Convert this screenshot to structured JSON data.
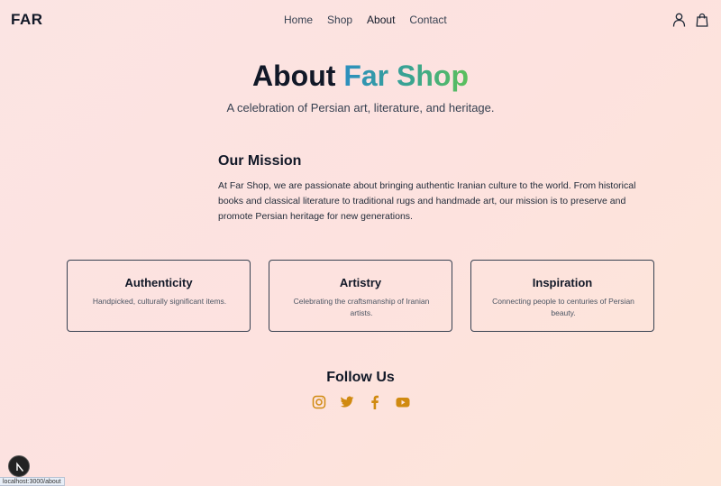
{
  "header": {
    "logo": "FAR",
    "nav": [
      "Home",
      "Shop",
      "About",
      "Contact"
    ],
    "active_nav": "About",
    "icons": [
      "user-icon",
      "shopping-bag-icon"
    ]
  },
  "hero": {
    "title_prefix": "About",
    "title_highlight": "Far Shop",
    "subtitle": "A celebration of Persian art, literature, and heritage."
  },
  "mission": {
    "title": "Our Mission",
    "text": "At Far Shop, we are passionate about bringing authentic Iranian culture to the world. From historical books and classical literature to traditional rugs and handmade art, our mission is to preserve and promote Persian heritage for new generations."
  },
  "cards": [
    {
      "title": "Authenticity",
      "text": "Handpicked, culturally significant items."
    },
    {
      "title": "Artistry",
      "text": "Celebrating the craftsmanship of Iranian artists."
    },
    {
      "title": "Inspiration",
      "text": "Connecting people to centuries of Persian beauty."
    }
  ],
  "follow": {
    "title": "Follow Us",
    "icons": [
      "instagram-icon",
      "twitter-icon",
      "facebook-icon",
      "youtube-icon"
    ],
    "icon_color": "#d08a10"
  },
  "colors": {
    "gradient_start": "#2d8fbf",
    "gradient_end": "#5cc05b",
    "text_dark": "#111827"
  },
  "status_bar": {
    "url": "localhost:3000/about"
  }
}
